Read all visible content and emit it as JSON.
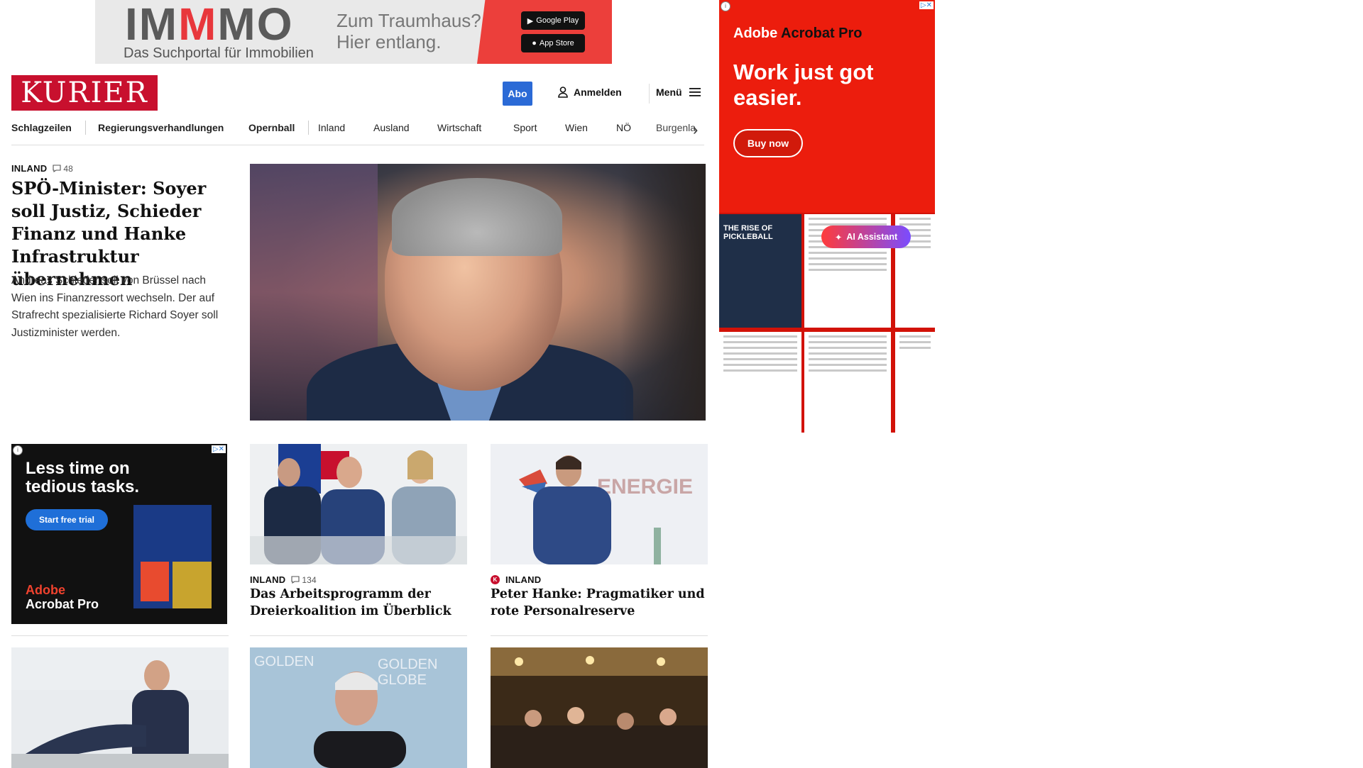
{
  "banner_ad": {
    "logo_left": "IM",
    "logo_mid": "M",
    "logo_right": "MO",
    "tagline": "Das Suchportal für Immobilien",
    "slogan": "Zum Traumhaus? Hier entlang.",
    "google_play": "Google Play",
    "app_store": "App Store"
  },
  "header": {
    "logo": "KURIER",
    "abo": "Abo",
    "login": "Anmelden",
    "menu": "Menü"
  },
  "nav": {
    "items": [
      "Schlagzeilen",
      "Regierungsverhandlungen",
      "Opernball",
      "Inland",
      "Ausland",
      "Wirtschaft",
      "Sport",
      "Wien",
      "NÖ",
      "Burgenla"
    ]
  },
  "lead": {
    "category": "INLAND",
    "comments": "48",
    "title": "SPÖ-Minister: Soyer soll Justiz, Schieder Finanz und Hanke Infrastruktur übernehmen",
    "teaser": "Andreas Schieder soll von Brüssel nach Wien ins Finanzressort wechseln. Der auf Strafrecht spezialisierte Richard Soyer soll Justizminister werden."
  },
  "mid_ad": {
    "headline": "Less time on tedious tasks.",
    "cta": "Start free trial",
    "brand_line1": "Adobe",
    "brand_line2": "Acrobat Pro"
  },
  "cards": [
    {
      "category": "INLAND",
      "comments": "134",
      "title": "Das Arbeitsprogramm der Dreierkoalition im Überblick"
    },
    {
      "category": "INLAND",
      "premium": true,
      "title": "Peter Hanke: Pragmatiker und rote Personalreserve"
    }
  ],
  "right_ad": {
    "brand_a": "Adobe",
    "brand_b": "Acrobat Pro",
    "headline": "Work just got easier.",
    "cta": "Buy now",
    "ai_pill": "AI Assistant",
    "doc_title": "THE RISE OF PICKLEBALL"
  },
  "icons": {
    "comment": "comment-icon",
    "user": "user-icon",
    "menu": "hamburger-icon",
    "nav_next": "chevron-right-icon"
  },
  "colors": {
    "brand_red": "#c8102e",
    "abo_blue": "#2b6ad6",
    "adobe_red": "#ec1d0d"
  }
}
